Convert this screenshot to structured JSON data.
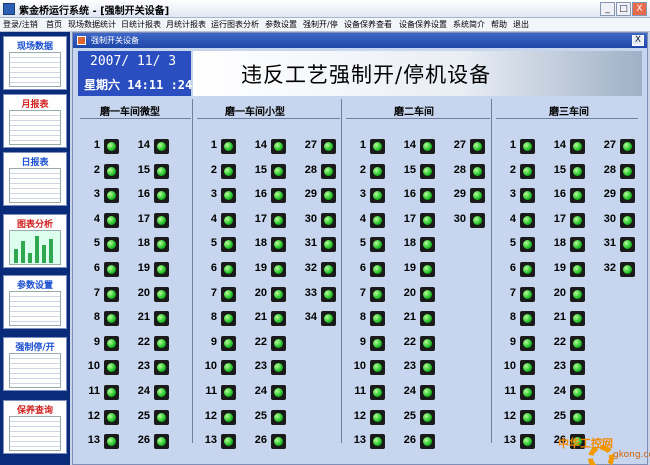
{
  "window": {
    "title": "紫金桥运行系统 - [强制开关设备]",
    "min_label": "_",
    "max_label": "□",
    "close_label": "X"
  },
  "menu": [
    "登录/注销",
    "首页",
    "现场数据统计",
    "日统计报表",
    "月统计报表",
    "运行图表分析",
    "参数设置",
    "强制开/停",
    "设备保养查看",
    "设备保养设置",
    "系统简介",
    "帮助",
    "退出"
  ],
  "sidebar": [
    {
      "label": "现场数据",
      "color": "#1a4fd0"
    },
    {
      "label": "月报表",
      "color": "#d02020"
    },
    {
      "label": "日报表",
      "color": "#1a4fd0"
    },
    {
      "label": "图表分析",
      "color": "#d02020"
    },
    {
      "label": "参数设置",
      "color": "#1a4fd0"
    },
    {
      "label": "强制停/开",
      "color": "#1a4fd0"
    },
    {
      "label": "保养查询",
      "color": "#d02020"
    }
  ],
  "child_window": {
    "title": "强制开关设备",
    "close_label": "X"
  },
  "date": "2007/ 11/ 3",
  "time": "星期六 14:11 :24",
  "heading": "违反工艺强制开/停机设备",
  "groups": [
    {
      "title": "磨一车间微型",
      "columns": [
        [
          1,
          2,
          3,
          4,
          5,
          6,
          7,
          8,
          9,
          10,
          11,
          12,
          13
        ],
        [
          14,
          15,
          16,
          17,
          18,
          19,
          20,
          21,
          22,
          23,
          24,
          25,
          26
        ]
      ]
    },
    {
      "title": "磨一车间小型",
      "columns": [
        [
          1,
          2,
          3,
          4,
          5,
          6,
          7,
          8,
          9,
          10,
          11,
          12,
          13
        ],
        [
          14,
          15,
          16,
          17,
          18,
          19,
          20,
          21,
          22,
          23,
          24,
          25,
          26
        ],
        [
          27,
          28,
          29,
          30,
          31,
          32,
          33,
          34
        ]
      ]
    },
    {
      "title": "磨二车间",
      "columns": [
        [
          1,
          2,
          3,
          4,
          5,
          6,
          7,
          8,
          9,
          10,
          11,
          12,
          13
        ],
        [
          14,
          15,
          16,
          17,
          18,
          19,
          20,
          21,
          22,
          23,
          24,
          25,
          26
        ],
        [
          27,
          28,
          29,
          30
        ]
      ]
    },
    {
      "title": "磨三车间",
      "columns": [
        [
          1,
          2,
          3,
          4,
          5,
          6,
          7,
          8,
          9,
          10,
          11,
          12,
          13
        ],
        [
          14,
          15,
          16,
          17,
          18,
          19,
          20,
          21,
          22,
          23,
          24,
          25,
          26
        ],
        [
          27,
          28,
          29,
          30,
          31,
          32
        ]
      ]
    }
  ],
  "watermark": {
    "text": "中华工控网",
    "url": "gkong.com"
  }
}
